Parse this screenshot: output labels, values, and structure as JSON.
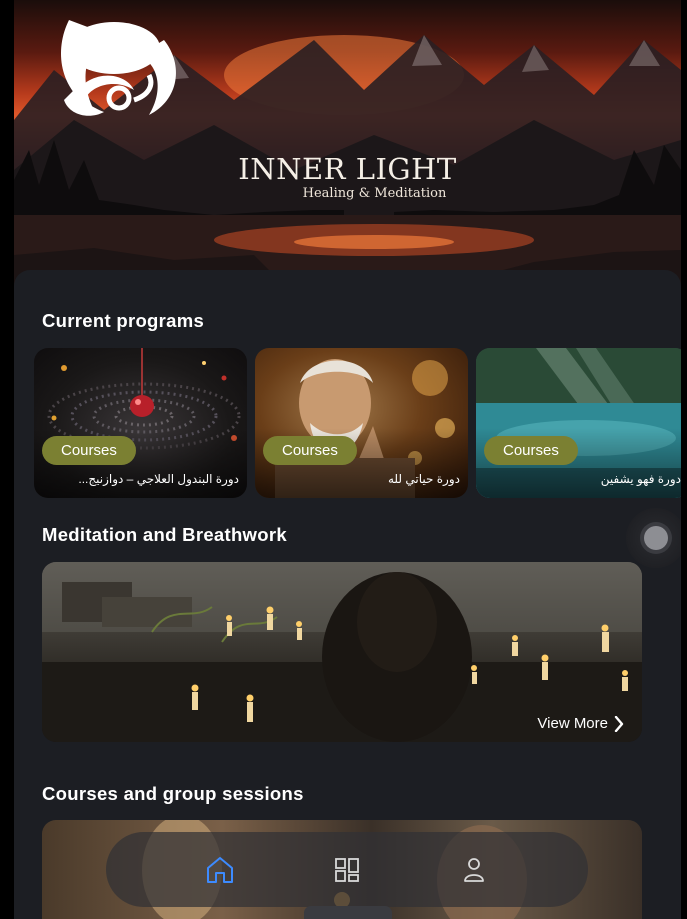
{
  "brand": {
    "title": "INNER LIGHT",
    "subtitle": "Healing & Meditation"
  },
  "sections": {
    "current_programs": "Current programs",
    "meditation": "Meditation and Breathwork",
    "courses": "Courses and group sessions"
  },
  "programs": [
    {
      "badge": "Courses",
      "title": "دورة البندول العلاجي – دوازنيج..."
    },
    {
      "badge": "Courses",
      "title": "دورة حياتي لله"
    },
    {
      "badge": "Courses",
      "title": "دورة فهو يشفين"
    }
  ],
  "meditation_banner": {
    "view_more": "View More"
  },
  "nav": {
    "items": [
      {
        "icon": "home-icon",
        "active": true
      },
      {
        "icon": "grid-icon",
        "active": false
      },
      {
        "icon": "user-icon",
        "active": false
      }
    ]
  },
  "colors": {
    "background": "#17191e",
    "sheet": "#1c1e23",
    "badge": "#7b8032",
    "nav_active": "#3d8bff",
    "nav_inactive": "#d9d9d9"
  }
}
